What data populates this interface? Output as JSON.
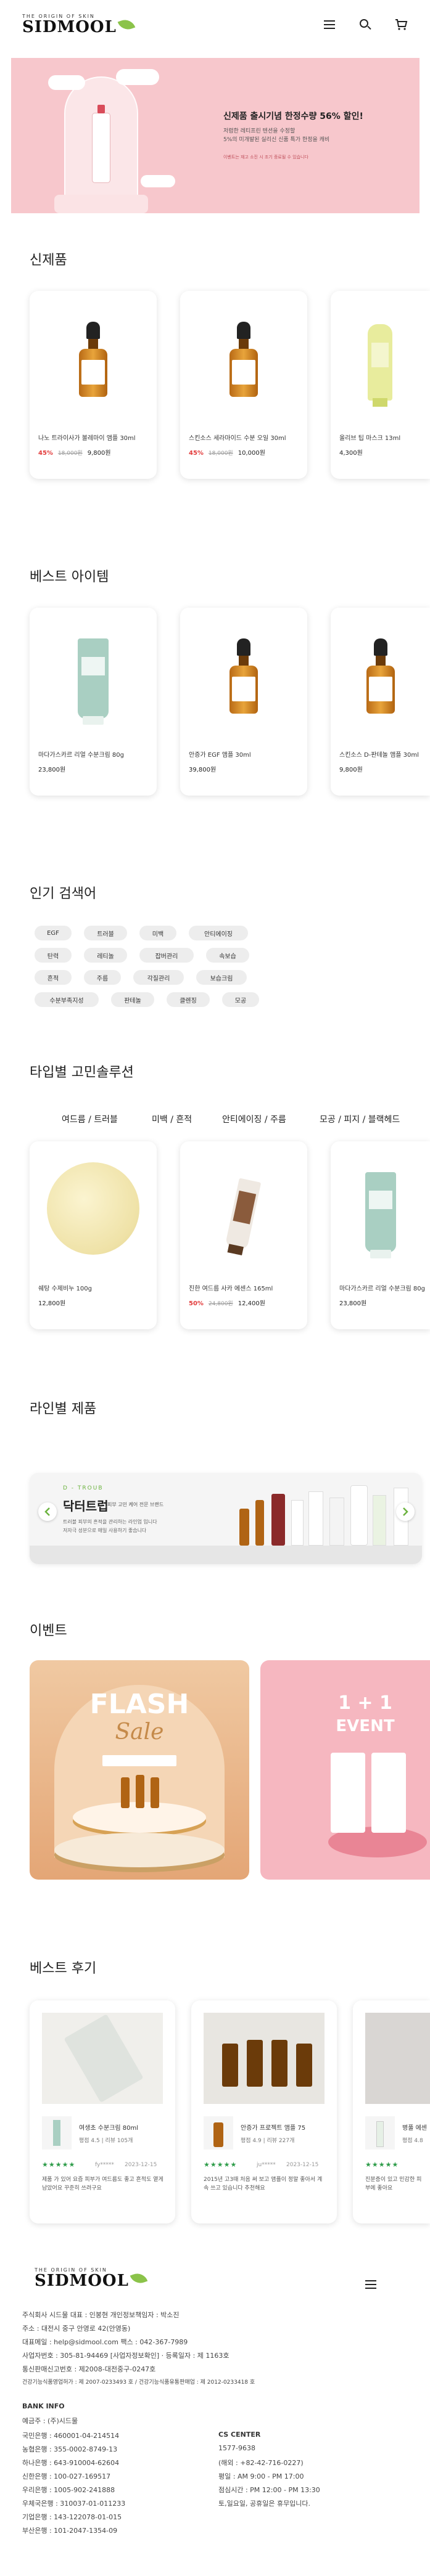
{
  "header": {
    "logo_tagline": "THE ORIGIN OF SKIN",
    "logo_word": "SIDMOOL",
    "icons": [
      "menu-icon",
      "search-icon",
      "cart-icon"
    ]
  },
  "banner": {
    "title": "신제품 출시기념 한정수량 56% 할인!",
    "line1": "저렴한 레티프린 텐션을 수정할",
    "line2": "5%의 미개발된 실리신 신품 특가 한정을 캐비",
    "note": "이벤트는 재고 소진 시 조기 종료될 수 있습니다"
  },
  "new_products": {
    "title": "신제품",
    "items": [
      {
        "name": "나노 트라이사가 볼레마이 앰플 30ml",
        "discount": "45%",
        "original": "18,000원",
        "price": "9,800원"
      },
      {
        "name": "스킨소스 세라마이드 수분 오일 30ml",
        "discount": "45%",
        "original": "18,000원",
        "price": "10,000원"
      },
      {
        "name": "올리브 팁 마스크 13ml",
        "discount": "",
        "original": "",
        "price": "4,300원"
      }
    ]
  },
  "best_items": {
    "title": "베스트 아이템",
    "items": [
      {
        "name": "마다가스카르 리얼 수분크림 80g",
        "price": "23,800원"
      },
      {
        "name": "안증가 EGF 앰플 30ml",
        "price": "39,800원"
      },
      {
        "name": "스킨소스 D-판테놀 앰플 30ml",
        "price": "9,800원"
      }
    ]
  },
  "popular_search": {
    "title": "인기 검색어",
    "tags": [
      "EGF",
      "트러블",
      "미백",
      "안티에이징",
      "탄력",
      "레티놀",
      "잡버관리",
      "속보습",
      "흔적",
      "주름",
      "각질관리",
      "보습크림",
      "수분부족지성",
      "판테놀",
      "클렌징",
      "모공"
    ]
  },
  "type_solution": {
    "title": "타입별 고민솔루션",
    "tabs": [
      "여드름 / 트러블",
      "미백 / 흔적",
      "안티에이징 / 주름",
      "모공 / 피지 / 블랙헤드"
    ],
    "items": [
      {
        "name": "쉐탕 수제비누 100g",
        "discount": "",
        "original": "",
        "price": "12,800원"
      },
      {
        "name": "진한 여드름 사카 에센스 165ml",
        "discount": "50%",
        "original": "24,800원",
        "price": "12,400원"
      },
      {
        "name": "마다가스카르 리얼 수분크림 80g",
        "discount": "",
        "original": "",
        "price": "23,800원"
      }
    ]
  },
  "line_products": {
    "title": "라인별 제품",
    "brand_small": "D - TROUB",
    "name": "닥터트럽",
    "desc1": "피부 고민 케어 전문 브랜드",
    "desc2": "트러블 피부의 흔적을 관리하는 라인업 입니다",
    "desc3": "저자극 성분으로 매일 사용하기 좋습니다"
  },
  "events": {
    "title": "이벤트",
    "flash_line1": "FLASH",
    "flash_line2": "Sale",
    "one_plus_one": "1 + 1",
    "event_word": "EVENT"
  },
  "reviews": {
    "title": "베스트 후기",
    "items": [
      {
        "product": "여생초 수분크림 80ml",
        "meta": "평점 4.5 | 리뷰 105개",
        "stars": "★★★★★",
        "author": "fy*****",
        "date": "2023-12-15",
        "text": "제품 가 있어 요즘 피부가 여드름도 좋고 흔적도 옅게 남았어요 꾸준히 쓰려구요"
      },
      {
        "product": "안증가 프로젝트 앰플 75",
        "meta": "평점 4.9 | 리뷰 227개",
        "stars": "★★★★★",
        "author": "ju*****",
        "date": "2023-12-15",
        "text": "2015년 고3때 처음 써 보고 앰플이 정말 좋아서 계속 쓰고 있습니다 추천해요"
      },
      {
        "product": "병풀 에센스",
        "meta": "평점 4.8",
        "stars": "★★★★★",
        "author": "",
        "date": "",
        "text": "진분증이 있고 민감한 피부에 좋아요"
      }
    ]
  },
  "footer": {
    "logo_tagline": "THE ORIGIN OF SKIN",
    "logo_word": "SIDMOOL",
    "company_lines": [
      "주식회사 시드물 대표 : 인봉현 개인정보책임자 : 박소진",
      "주소 : 대전시 중구 안영로 42(안영동)",
      "대표메일 : help@sidmool.com 팩스 : 042-367-7989",
      "사업자번호 : 305-81-94469 [사업자정보확인] · 등록일자 : 제 1163호",
      "통신판매신고번호 : 제2008-대전중구-0247호",
      "건강기능식품영업허가 : 제 2007-0233493 호 / 건강기능식품유통판매업 : 제 2012-0233418 호"
    ],
    "bank_title": "BANK INFO",
    "bank_holder": "예금주 : (주)시드물",
    "banks": [
      "국민은행 : 460001-04-214514",
      "농협은행 : 355-0002-8749-13",
      "하나은행 : 643-910004-62604",
      "신한은행 : 100-027-169517",
      "우리은행 : 1005-902-241888",
      "우체국은행 : 310037-01-011233",
      "기업은행 : 143-122078-01-015",
      "부산은행 : 101-2047-1354-09"
    ],
    "cs_title": "CS CENTER",
    "cs_lines": [
      "1577-9638",
      "(해외 : +82-42-716-0227)",
      "평일 : AM 9:00 - PM 17:00",
      "점심시간 : PM 12:00 - PM 13:30",
      "토,일요일, 공휴일은 휴무입니다."
    ]
  }
}
